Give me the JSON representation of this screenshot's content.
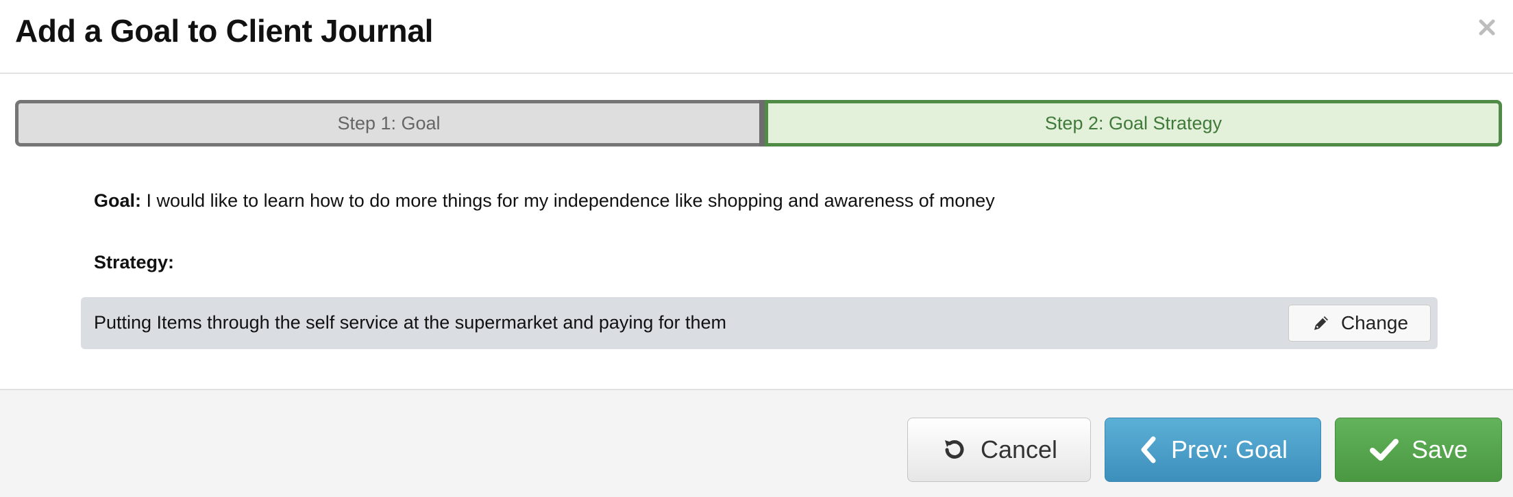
{
  "modal": {
    "title": "Add a Goal to Client Journal",
    "close_icon": "close-icon"
  },
  "steps": [
    {
      "label": "Step 1: Goal",
      "state": "inactive"
    },
    {
      "label": "Step 2: Goal Strategy",
      "state": "active"
    }
  ],
  "goal": {
    "label": "Goal:",
    "text": "I would like to learn how to do more things for my independence like shopping and awareness of money"
  },
  "strategy": {
    "label": "Strategy:",
    "text": "Putting Items through the self service at the supermarket and paying for them",
    "change_label": "Change",
    "change_icon": "pencil-icon"
  },
  "footer": {
    "cancel_label": "Cancel",
    "cancel_icon": "undo-icon",
    "prev_label": "Prev: Goal",
    "prev_icon": "chevron-left-icon",
    "save_label": "Save",
    "save_icon": "checkmark-icon"
  },
  "colors": {
    "step_active_bg": "#e3f0da",
    "step_active_border": "#4f8a47",
    "step_inactive_bg": "#dedede",
    "prev_button": "#4aa0c9",
    "save_button": "#56a64f"
  }
}
